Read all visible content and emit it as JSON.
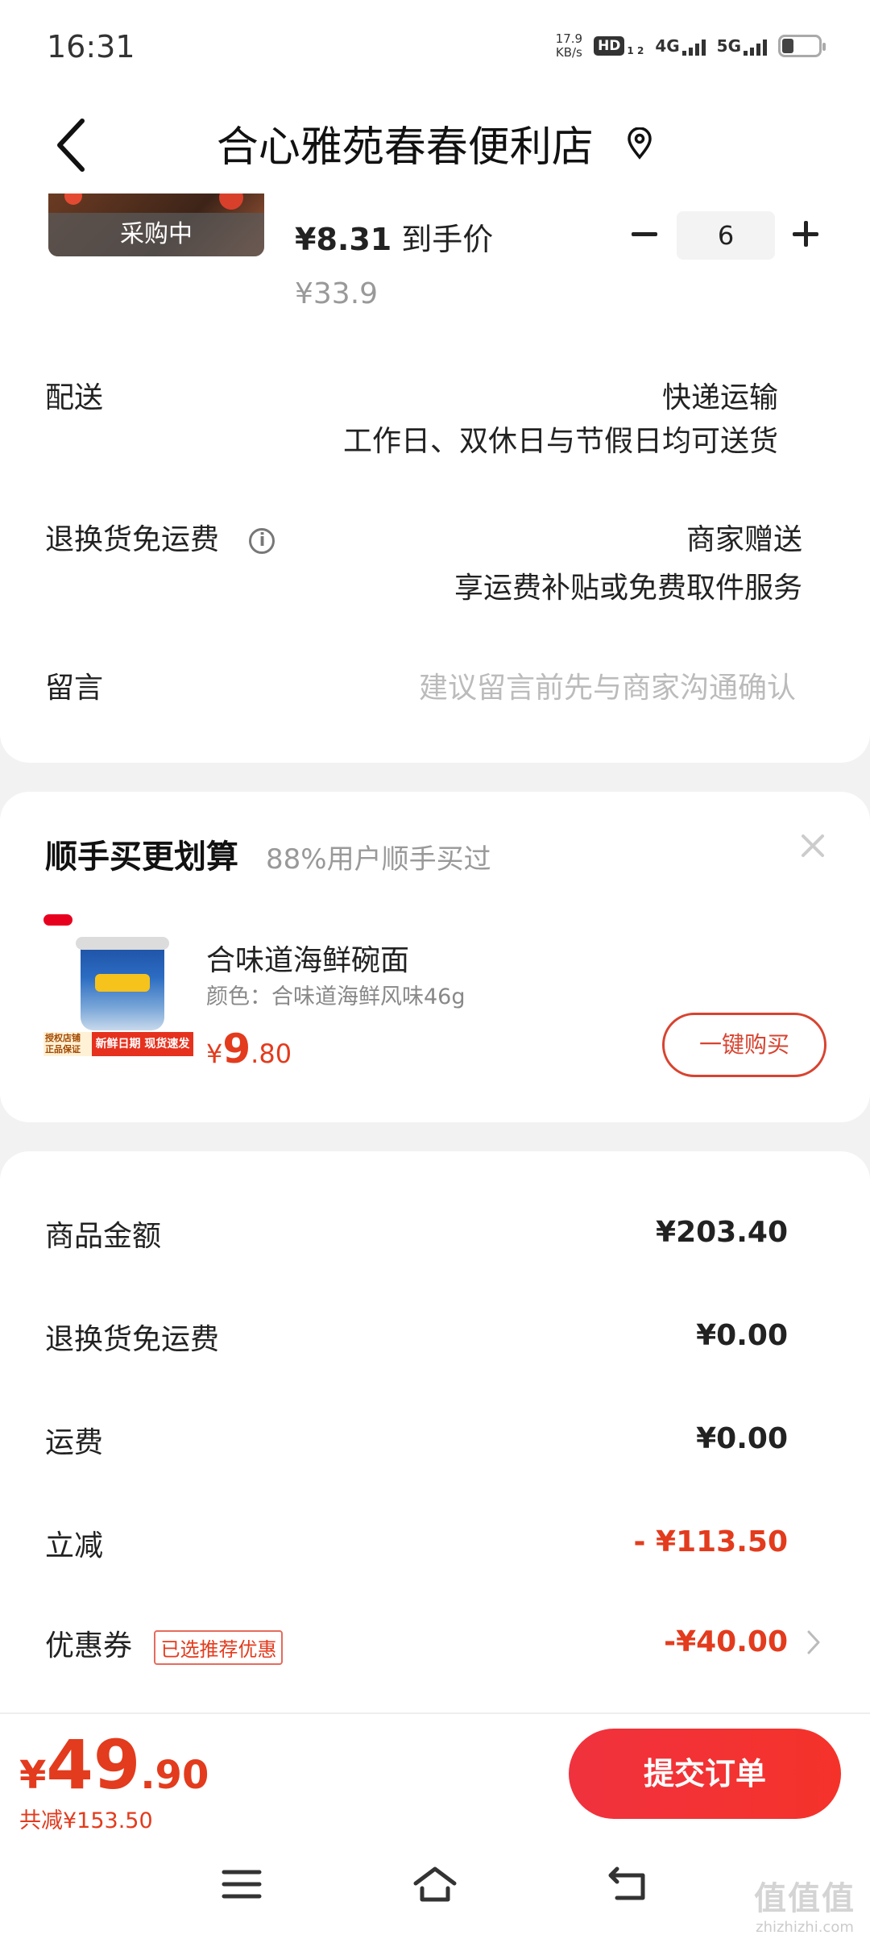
{
  "status_bar": {
    "time": "16:31",
    "net_speed_value": "17.9",
    "net_speed_unit": "KB/s",
    "hd_label": "HD",
    "hd_sub": "1 2",
    "sig_4g": "4G",
    "sig_5g": "5G"
  },
  "header": {
    "title": "合心雅苑春春便利店",
    "back_icon": "chevron-left-icon",
    "location_icon": "location-pin-icon"
  },
  "item": {
    "badge": "采购中",
    "final_price_value": "¥8.31",
    "final_price_label": "到手价",
    "original_price": "¥33.9",
    "quantity": "6"
  },
  "delivery": {
    "label": "配送",
    "method": "快递运输",
    "note": "工作日、双休日与节假日均可送货"
  },
  "return_shipping": {
    "label": "退换货免运费",
    "value": "商家赠送",
    "note": "享运费补贴或免费取件服务"
  },
  "message": {
    "label": "留言",
    "placeholder": "建议留言前先与商家沟通确认"
  },
  "recommendation": {
    "title": "顺手买更划算",
    "subtitle": "88%用户顺手买过",
    "product_name": "合味道海鲜碗面",
    "variant": "颜色：合味道海鲜风味46g",
    "price_currency": "¥",
    "price_int": "9",
    "price_dec": ".80",
    "promo_left": "授权店铺 正品保证",
    "promo_right": "新鲜日期 现货速发",
    "buy_button": "一键购买"
  },
  "summary": {
    "rows": [
      {
        "label": "商品金额",
        "value": "¥203.40"
      },
      {
        "label": "退换货免运费",
        "value": "¥0.00"
      },
      {
        "label": "运费",
        "value": "¥0.00"
      },
      {
        "label": "立减",
        "value": "- ¥113.50"
      },
      {
        "label": "优惠券",
        "value": "-¥40.00",
        "tag": "已选推荐优惠"
      }
    ]
  },
  "bottom": {
    "total_currency": "¥",
    "total_int": "49",
    "total_dec": ".90",
    "saved": "共减¥153.50",
    "submit": "提交订单"
  },
  "watermark": {
    "big": "值值值",
    "small": "zhizhizhi.com"
  },
  "colors": {
    "accent_red": "#e33b1d",
    "button_red": "#f0323e"
  }
}
